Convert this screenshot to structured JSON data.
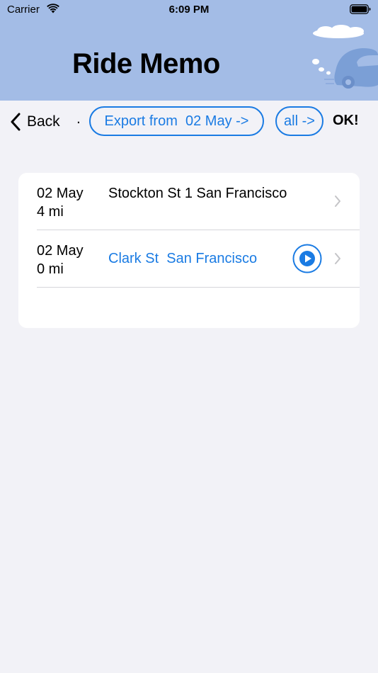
{
  "status_bar": {
    "carrier": "Carrier",
    "time": "6:09 PM",
    "icons": [
      "wifi-icon",
      "battery-icon"
    ]
  },
  "header": {
    "title": "Ride Memo",
    "background_color": "#a3bce6",
    "art": [
      "cloud-icon",
      "car-icon"
    ]
  },
  "toolbar": {
    "back_label": "Back",
    "separator": ".",
    "export_label": "Export from  02 May ->",
    "all_label": "all ->",
    "ok_label": "OK!",
    "accent_color": "#1a7be3"
  },
  "rides": [
    {
      "date": "02 May",
      "distance": "4 mi",
      "address": "Stockton St 1 San Francisco",
      "highlighted": false
    },
    {
      "date": "02 May",
      "distance": "0 mi",
      "address": "Clark St  San Francisco",
      "highlighted": true
    }
  ]
}
